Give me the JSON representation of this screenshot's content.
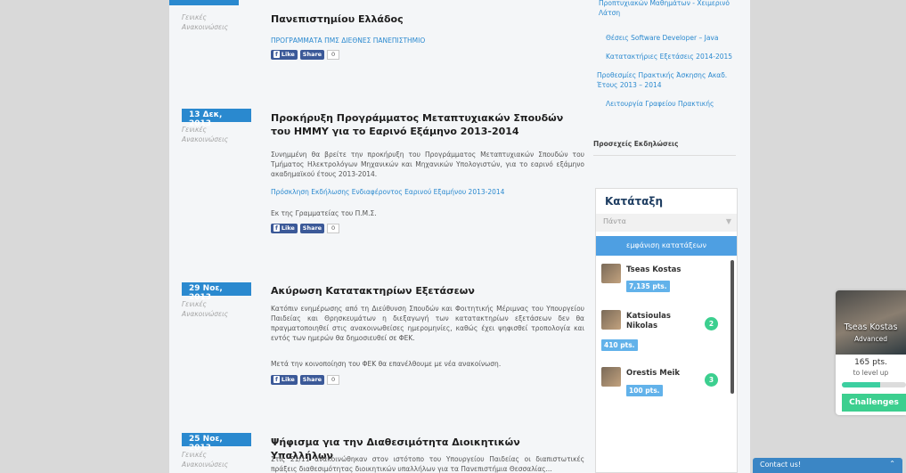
{
  "posts": [
    {
      "date": "",
      "meta": [
        "Γενικές",
        "Ανακοινώσεις"
      ],
      "title": "Πανεπιστημίου Ελλάδος",
      "link": "ΠΡΟΓΡΑΜΜΑΤΑ ΠΜΣ ΔΙΕΘΝΕΣ ΠΑΝΕΠΙΣΤΗΜΙΟ",
      "like": "Like",
      "share": "Share",
      "count": "0"
    },
    {
      "date": "13 Δεκ, 2013",
      "meta": [
        "Γενικές",
        "Ανακοινώσεις"
      ],
      "title": "Προκήρυξη Προγράμματος Μεταπτυχιακών Σπουδών του ΗΜΜΥ για το Εαρινό Εξάμηνο 2013-2014",
      "text": "Συνημμένη θα βρείτε την προκήρυξη του Προγράμματος Μεταπτυχιακών Σπουδών του Τμήματος Ηλεκτρολόγων Μηχανικών και Μηχανικών Υπολογιστών, για το εαρινό εξάμηνο ακαδημαϊκού έτους 2013-2014.",
      "link": "Πρόσκληση Εκδήλωσης Ενδιαφέροντος Εαρινού Εξαμήνου 2013-2014",
      "sign": "Εκ της Γραμματείας του Π.Μ.Σ.",
      "like": "Like",
      "share": "Share",
      "count": "0"
    },
    {
      "date": "29 Νοε, 2013",
      "meta": [
        "Γενικές",
        "Ανακοινώσεις"
      ],
      "title": "Ακύρωση Κατατακτηρίων Εξετάσεων",
      "text": "Κατόπιν ενημέρωσης από τη Διεύθυνση Σπουδών και Φοιτητικής Μέριμνας του Υπουργείου Παιδείας και Θρησκευμάτων η διεξαγωγή των κατατακτηρίων εξετάσεων δεν θα πραγματοποιηθεί στις ανακοινωθείσες ημερομηνίες, καθώς έχει ψηφισθεί τροπολογία και εντός των ημερών θα δημοσιευθεί σε ΦΕΚ.",
      "text2": "Μετά την κοινοποίηση του ΦΕΚ θα επανέλθουμε με νέα ανακοίνωση.",
      "like": "Like",
      "share": "Share",
      "count": "0"
    },
    {
      "date": "25 Νοε, 2013",
      "meta": [
        "Γενικές",
        "Ανακοινώσεις"
      ],
      "title": "Ψήφισμα για την Διαθεσιμότητα Διοικητικών Υπαλλήλων",
      "text": "Στις 21/11 ανακοινώθηκαν στον ιστότοπο του Υπουργείου Παιδείας οι διαπιστωτικές πράξεις διαθεσιμότητας διοικητικών υπαλλήλων για τα Πανεπιστήμια Θεσσαλίας..."
    }
  ],
  "sidebar": {
    "links": [
      "Προπτυχιακών Μαθημάτων - Χειμερινό Λάτση",
      "Θέσεις Software Developer – Java",
      "Κατατακτήριες Εξετάσεις 2014-2015",
      "Προθεσμίες Πρακτικής Άσκησης Ακαδ. Έτους 2013 – 2014",
      "Λειτουργία Γραφείου Πρακτικής"
    ],
    "events_heading": "Προσεχείς Εκδηλώσεις",
    "ranking": {
      "title": "Κατάταξη",
      "select_value": "Πάντα",
      "button": "εμφάνιση κατατάξεων",
      "items": [
        {
          "name": "Tseas Kostas",
          "pts": "7,135 pts.",
          "badge": ""
        },
        {
          "name": "Katsioulas Nikolas",
          "pts": "410 pts.",
          "badge": "2"
        },
        {
          "name": "Orestis Meik",
          "pts": "100 pts.",
          "badge": "3"
        }
      ]
    }
  },
  "widget": {
    "name": "Tseas Kostas",
    "level": "Advanced",
    "points": "165 pts.",
    "to_level": "to level up",
    "progress": 0.6,
    "challenges": "Challenges"
  },
  "contact": {
    "label": "Contact us!"
  },
  "colors": {
    "accent": "#2a89cf",
    "green": "#3ccf8f"
  }
}
